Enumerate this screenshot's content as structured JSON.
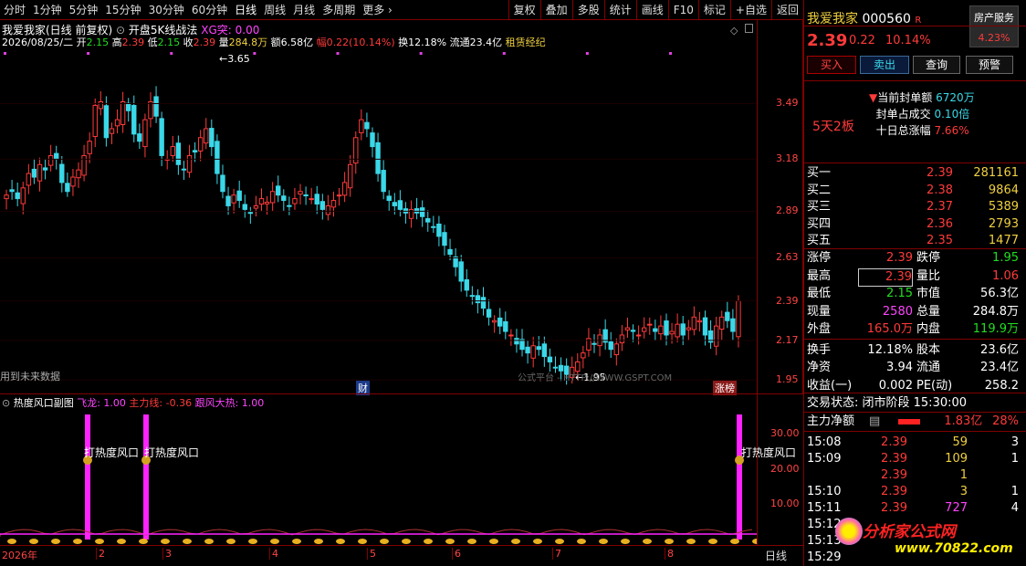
{
  "toolbar": {
    "left": [
      "分时",
      "1分钟",
      "5分钟",
      "15分钟",
      "30分钟",
      "60分钟",
      "日线",
      "周线",
      "月线",
      "多周期",
      "更多 ›"
    ],
    "right": [
      "复权",
      "叠加",
      "多股",
      "统计",
      "画线",
      "F10",
      "标记",
      "+自选",
      "返回"
    ]
  },
  "stock": {
    "name": "我爱我家",
    "code": "000560",
    "flag": "R",
    "sector": "房产服务",
    "sector_pct": "4.23%",
    "price": "2.39",
    "change": "0.22",
    "pct": "10.14%",
    "streak": "5天2板"
  },
  "chart_hdr": {
    "title": "我爱我家(日线 前复权)",
    "indicator": "开盘5K线战法",
    "xg": "XG突: 0.00"
  },
  "bar_info": {
    "date": "2026/08/25/二",
    "open_l": "开",
    "open": "2.15",
    "high_l": "高",
    "high": "2.39",
    "low_l": "低",
    "low": "2.15",
    "close_l": "收",
    "close": "2.39",
    "vol_l": "量",
    "vol": "284.8万",
    "amt_l": "额",
    "amt": "6.58亿",
    "amp_l": "幅",
    "amp": "0.22(10.14%)",
    "turn_l": "换",
    "turn": "12.18%",
    "float_l": "流通",
    "float": "23.4亿",
    "concept": "租赁经纪"
  },
  "yaxis": [
    "3.49",
    "3.18",
    "2.89",
    "2.63",
    "2.39",
    "2.17",
    "1.95"
  ],
  "annot": {
    "hi": "3.65",
    "lo": "1.95",
    "future": "用到未来数据",
    "cai": "财",
    "zb": "涨榜",
    "watermark": "公式平台 - HTTP://WWW.GSPT.COM"
  },
  "sub": {
    "title": "热度风口副图",
    "fl": "飞龙: 1.00",
    "zl": "主力线: -0.36",
    "gf": "跟风大热: 1.00",
    "yaxis": [
      "30.00",
      "20.00",
      "10.00"
    ],
    "tag": "打热度风口"
  },
  "xaxis": [
    "2026年",
    "2",
    "3",
    "4",
    "5",
    "6",
    "7",
    "8"
  ],
  "period": "日线",
  "fd": {
    "l1": "当前封单额",
    "v1": "6720万",
    "l2": "封单占成交",
    "v2": "0.10倍",
    "l3": "十日总涨幅",
    "v3": "7.66%"
  },
  "book": [
    {
      "l": "买一",
      "p": "2.39",
      "v": "281161"
    },
    {
      "l": "买二",
      "p": "2.38",
      "v": "9864"
    },
    {
      "l": "买三",
      "p": "2.37",
      "v": "5389"
    },
    {
      "l": "买四",
      "p": "2.36",
      "v": "2793"
    },
    {
      "l": "买五",
      "p": "2.35",
      "v": "1477"
    }
  ],
  "stats": [
    {
      "a": "涨停",
      "b": "2.39",
      "c": "跌停",
      "d": "1.95"
    },
    {
      "a": "最高",
      "b": "2.39",
      "c": "量比",
      "d": "1.06"
    },
    {
      "a": "最低",
      "b": "2.15",
      "c": "市值",
      "d": "56.3亿"
    },
    {
      "a": "现量",
      "b": "2580",
      "c": "总量",
      "d": "284.8万"
    },
    {
      "a": "外盘",
      "b": "165.0万",
      "c": "内盘",
      "d": "119.9万"
    },
    {
      "a": "换手",
      "b": "12.18%",
      "c": "股本",
      "d": "23.6亿"
    },
    {
      "a": "净资",
      "b": "3.94",
      "c": "流通",
      "d": "23.4亿"
    },
    {
      "a": "收益(一)",
      "b": "0.002",
      "c": "PE(动)",
      "d": "258.2"
    }
  ],
  "trade": {
    "state": "交易状态: 闭市阶段 15:30:00",
    "net": "主力净额",
    "net_v": "1.83亿",
    "net_p": "28%"
  },
  "ticks": [
    {
      "t": "15:08",
      "p": "2.39",
      "v": "59",
      "n": "3"
    },
    {
      "t": "15:09",
      "p": "2.39",
      "v": "109",
      "n": "1"
    },
    {
      "t": "",
      "p": "2.39",
      "v": "1",
      "n": ""
    },
    {
      "t": "15:10",
      "p": "2.39",
      "v": "3",
      "n": "1"
    },
    {
      "t": "15:11",
      "p": "2.39",
      "v": "727",
      "n": "4"
    },
    {
      "t": "15:12",
      "p": "",
      "v": "",
      "n": ""
    },
    {
      "t": "15:13",
      "p": "",
      "v": "",
      "n": ""
    },
    {
      "t": "15:29",
      "p": "",
      "v": "",
      "n": ""
    }
  ],
  "buttons": [
    "买入",
    "卖出",
    "查询",
    "预警"
  ],
  "logo": {
    "name": "分析家公式网",
    "url": "www.70822.com"
  },
  "chart_data": {
    "type": "candlestick",
    "close": [
      2.98,
      3.0,
      2.96,
      3.02,
      3.1,
      3.08,
      3.15,
      3.12,
      3.2,
      3.18,
      3.05,
      3.0,
      3.08,
      3.12,
      3.2,
      3.28,
      3.48,
      3.5,
      3.3,
      3.35,
      3.4,
      3.5,
      3.45,
      3.32,
      3.28,
      3.4,
      3.5,
      3.42,
      3.2,
      3.18,
      3.25,
      3.15,
      3.12,
      3.2,
      3.22,
      3.3,
      3.35,
      3.25,
      3.1,
      3.0,
      2.92,
      2.98,
      2.95,
      2.9,
      2.88,
      2.92,
      2.96,
      2.94,
      3.0,
      2.98,
      2.95,
      2.92,
      2.96,
      3.0,
      2.98,
      2.96,
      2.93,
      2.9,
      2.92,
      2.95,
      2.98,
      3.05,
      3.15,
      3.3,
      3.4,
      3.35,
      3.25,
      3.1,
      3.0,
      2.95,
      2.92,
      2.9,
      2.88,
      2.9,
      2.88,
      2.86,
      2.83,
      2.8,
      2.75,
      2.7,
      2.65,
      2.58,
      2.5,
      2.45,
      2.42,
      2.38,
      2.35,
      2.3,
      2.28,
      2.25,
      2.22,
      2.2,
      2.15,
      2.12,
      2.1,
      2.14,
      2.12,
      2.08,
      2.05,
      2.02,
      2.0,
      1.98,
      2.02,
      2.05,
      2.1,
      2.18,
      2.15,
      2.2,
      2.16,
      2.12,
      2.15,
      2.2,
      2.24,
      2.22,
      2.2,
      2.24,
      2.26,
      2.22,
      2.25,
      2.2,
      2.22,
      2.26,
      2.2,
      2.24,
      2.3,
      2.28,
      2.2,
      2.16,
      2.25,
      2.3,
      2.28,
      2.22,
      2.39
    ]
  }
}
